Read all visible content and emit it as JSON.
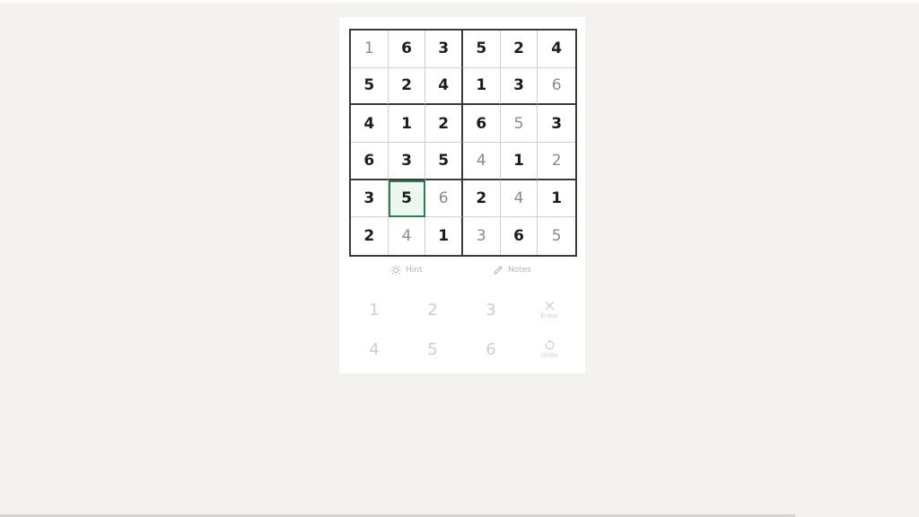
{
  "board": {
    "cells": [
      [
        {
          "v": "1",
          "t": "user"
        },
        {
          "v": "6",
          "t": "given"
        },
        {
          "v": "3",
          "t": "given"
        },
        {
          "v": "5",
          "t": "given"
        },
        {
          "v": "2",
          "t": "given"
        },
        {
          "v": "4",
          "t": "given"
        }
      ],
      [
        {
          "v": "5",
          "t": "given"
        },
        {
          "v": "2",
          "t": "given"
        },
        {
          "v": "4",
          "t": "given"
        },
        {
          "v": "1",
          "t": "given"
        },
        {
          "v": "3",
          "t": "given"
        },
        {
          "v": "6",
          "t": "user"
        }
      ],
      [
        {
          "v": "4",
          "t": "given"
        },
        {
          "v": "1",
          "t": "given"
        },
        {
          "v": "2",
          "t": "given"
        },
        {
          "v": "6",
          "t": "given"
        },
        {
          "v": "5",
          "t": "user"
        },
        {
          "v": "3",
          "t": "given"
        }
      ],
      [
        {
          "v": "6",
          "t": "given"
        },
        {
          "v": "3",
          "t": "given"
        },
        {
          "v": "5",
          "t": "given"
        },
        {
          "v": "4",
          "t": "user"
        },
        {
          "v": "1",
          "t": "given"
        },
        {
          "v": "2",
          "t": "user"
        }
      ],
      [
        {
          "v": "3",
          "t": "given"
        },
        {
          "v": "5",
          "t": "given"
        },
        {
          "v": "6",
          "t": "user"
        },
        {
          "v": "2",
          "t": "given"
        },
        {
          "v": "4",
          "t": "user"
        },
        {
          "v": "1",
          "t": "given"
        }
      ],
      [
        {
          "v": "2",
          "t": "given"
        },
        {
          "v": "4",
          "t": "user"
        },
        {
          "v": "1",
          "t": "given"
        },
        {
          "v": "3",
          "t": "user"
        },
        {
          "v": "6",
          "t": "given"
        },
        {
          "v": "5",
          "t": "user"
        }
      ]
    ],
    "selected": [
      4,
      1
    ]
  },
  "tools": {
    "hint_label": "Hint",
    "notes_label": "Notes"
  },
  "keypad": {
    "keys": [
      "1",
      "2",
      "3",
      "4",
      "5",
      "6"
    ],
    "erase_label": "Erase",
    "undo_label": "Undo"
  },
  "colors": {
    "selected_outline": "#2f7d57",
    "selected_fill": "#eef6f0",
    "given_digit": "#1c1c1c",
    "user_digit": "#8a8a8a"
  }
}
